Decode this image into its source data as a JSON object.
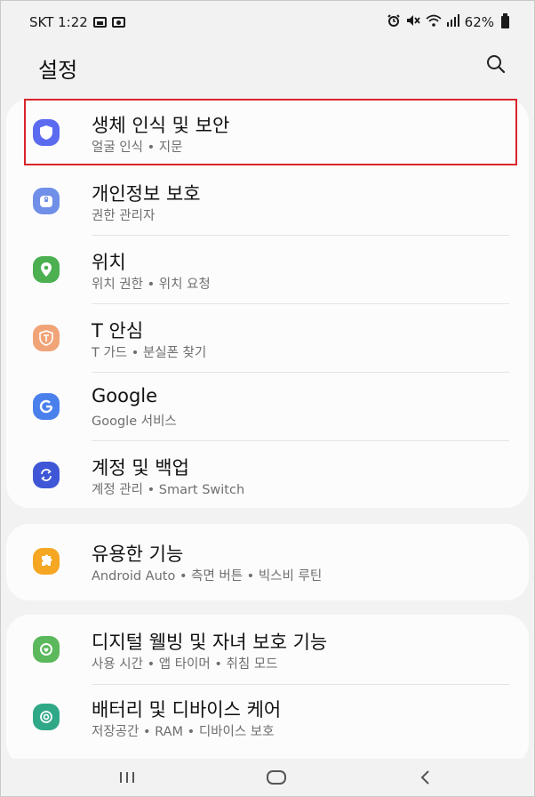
{
  "status_bar": {
    "carrier_time": "SKT 1:22",
    "battery_percent": "62%"
  },
  "header": {
    "title": "설정"
  },
  "groups": [
    {
      "items": [
        {
          "title": "생체 인식 및 보안",
          "subtitle": "얼굴 인식 • 지문",
          "icon": "shield-icon",
          "color": "#5b6bf0"
        },
        {
          "title": "개인정보 보호",
          "subtitle": "권한 관리자",
          "icon": "privacy-icon",
          "color": "#6f8fe8"
        },
        {
          "title": "위치",
          "subtitle": "위치 권한 • 위치 요청",
          "icon": "location-pin-icon",
          "color": "#4caf50"
        },
        {
          "title": "T 안심",
          "subtitle": "T 가드 • 분실폰 찾기",
          "icon": "t-safe-icon",
          "color": "#f0a478"
        },
        {
          "title": "Google",
          "subtitle": "Google 서비스",
          "icon": "google-icon",
          "color": "#4a80ec"
        },
        {
          "title": "계정 및 백업",
          "subtitle": "계정 관리 • Smart Switch",
          "icon": "sync-icon",
          "color": "#3f57d6"
        }
      ]
    },
    {
      "items": [
        {
          "title": "유용한 기능",
          "subtitle": "Android Auto • 측면 버튼 • 빅스비 루틴",
          "icon": "puzzle-icon",
          "color": "#f5a623"
        }
      ]
    },
    {
      "items": [
        {
          "title": "디지털 웰빙 및 자녀 보호 기능",
          "subtitle": "사용 시간 • 앱 타이머 • 취침 모드",
          "icon": "wellbeing-icon",
          "color": "#5cb85c"
        },
        {
          "title": "배터리 및 디바이스 케어",
          "subtitle": "저장공간 • RAM • 디바이스 보호",
          "icon": "device-care-icon",
          "color": "#2fa888"
        }
      ]
    }
  ],
  "highlighted_item": "생체 인식 및 보안",
  "colors": {
    "highlight_border": "#d9252b",
    "background": "#f2f2f2",
    "card": "#fcfcfc"
  }
}
